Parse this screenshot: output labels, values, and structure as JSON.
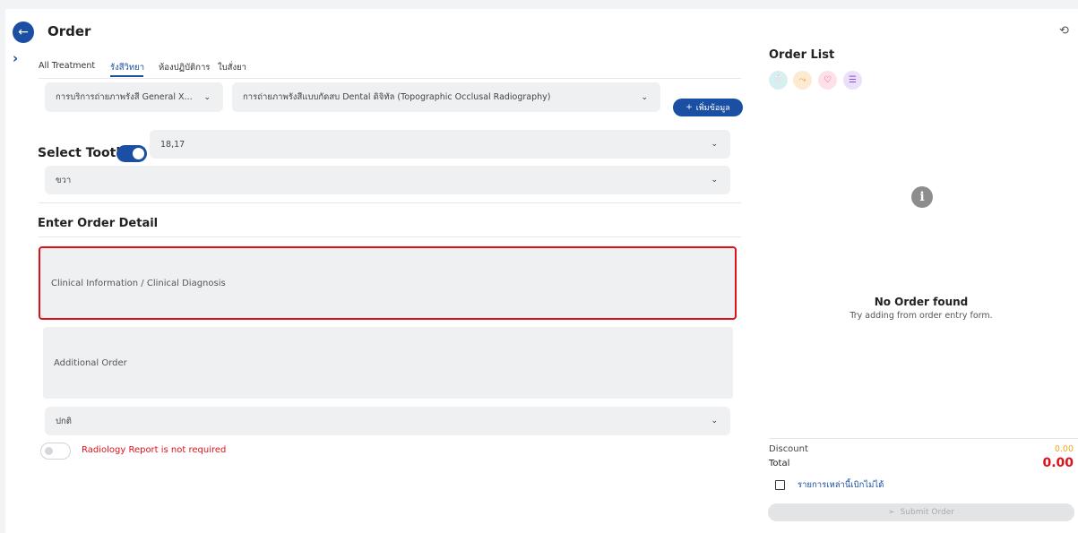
{
  "header": {
    "title": "Order",
    "back_icon": "←",
    "history_icon": "⟲",
    "expand_icon": "›"
  },
  "tabs": [
    {
      "label": "All Treatment",
      "active": false
    },
    {
      "label": "รังสีวิทยา",
      "active": true
    },
    {
      "label": "ห้องปฏิบัติการ",
      "active": false
    },
    {
      "label": "ใบสั่งยา",
      "active": false
    }
  ],
  "form": {
    "service_select": "การบริการถ่ายภาพรังสี General X...",
    "procedure_select": "การถ่ายภาพรังสีแบบกัดสบ Dental ดิจิทัล (Topographic Occlusal Radiography)",
    "add_button": "เพิ่มข้อมูล",
    "select_tooth_label": "Select Tooth",
    "tooth_value": "18,17",
    "side_value": "ขวา",
    "order_detail_heading": "Enter Order Detail",
    "clinical_info_placeholder": "Clinical Information / Clinical Diagnosis",
    "additional_order_placeholder": "Additional Order",
    "priority_value": "ปกติ",
    "radiology_report_text": "Radiology Report is not required"
  },
  "order_list": {
    "title": "Order List",
    "empty_title": "No Order found",
    "empty_subtitle": "Try adding from order entry form.",
    "discount_label": "Discount",
    "discount_value": "0.00",
    "total_label": "Total",
    "total_value": "0.00",
    "non_claimable_label": "รายการเหล่านี้เบิกไม่ได้",
    "submit_label": "Submit Order"
  },
  "colors": {
    "accent": "#1a4fa3",
    "warning": "#e0101b",
    "discount": "#f5a623"
  }
}
